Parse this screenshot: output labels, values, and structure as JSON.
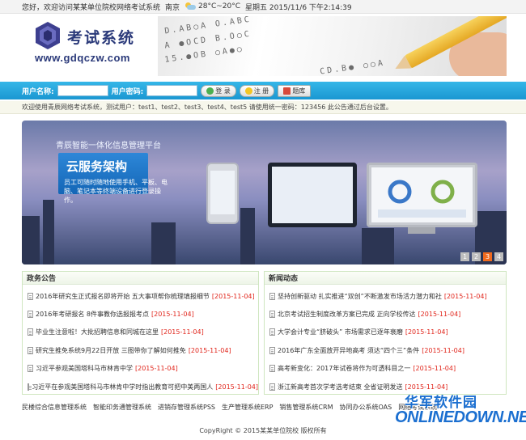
{
  "topbar": {
    "greeting": "您好，欢迎访问某某单位院校网络考试系统",
    "city": "南京",
    "temperature": "28°C~20°C",
    "datetime": "星期五 2015/11/6 下午2:14:39",
    "weather_icon": "partly-cloudy-icon"
  },
  "header": {
    "logo_title": "考试系统",
    "logo_url": "www.gdqczw.com",
    "banner_rows": [
      "D.AB○A O.ABC",
      "A ●OCD  B.O○C",
      "15.●OB  ○A●○",
      "CD.B● ○○A"
    ]
  },
  "login": {
    "username_label": "用户名称:",
    "password_label": "用户密码:",
    "login_button": "登 录",
    "register_button": "注 册",
    "question_bank_button": "题库"
  },
  "notice": {
    "text": "欢迎使用青辰网络考试系统，测试用户：test1、test2、test3、test4、test5 请使用统一密码：123456 此公告通过后台设置。"
  },
  "slider": {
    "subtitle": "青辰智能一体化信息管理平台",
    "headline": "云服务架构",
    "description": "员工可随时随地使用手机、平板、电脑、笔记本等终端设备进行登录操作。",
    "pages": [
      "1",
      "2",
      "3",
      "4"
    ],
    "active_page": "3"
  },
  "panels": {
    "left": {
      "title": "政务公告",
      "items": [
        {
          "text": "2016年研究生正式报名即将开始 五大事项帮你梳理填报细节",
          "date": "[2015-11-04]"
        },
        {
          "text": "2016年考研报名 8件事教你选报报考点",
          "date": "[2015-11-04]"
        },
        {
          "text": "毕业生注意啦！大批招聘信息和同城在这里",
          "date": "[2015-11-04]"
        },
        {
          "text": "研究生推免系统9月22日开放 三图带你了解如何推免",
          "date": "[2015-11-04]"
        },
        {
          "text": "习近平参观美国塔科马市林肯中学",
          "date": "[2015-11-04]"
        },
        {
          "text": "习近平在参观美国塔科马市林肯中学时指出教育可把中美两国人",
          "date": "[2015-11-04]"
        }
      ]
    },
    "right": {
      "title": "新闻动态",
      "items": [
        {
          "text": "坚持创新驱动 扎实推进“双创”不断激发市场活力潜力和社",
          "date": "[2015-11-04]"
        },
        {
          "text": "北京考试招生制度改革方案已完成 正向学校传达",
          "date": "[2015-11-04]"
        },
        {
          "text": "大学会计专业“脐破头” 市场需求已逐年衰磨",
          "date": "[2015-11-04]"
        },
        {
          "text": "2016年广东全面放开异地高考 须达“四个三”条件",
          "date": "[2015-11-04]"
        },
        {
          "text": "高考新变化：2017年试卷将作为可透科目之一",
          "date": "[2015-11-04]"
        },
        {
          "text": "浙江新高考首次学考选考结束 全省证明发送",
          "date": "[2015-11-04]"
        }
      ]
    }
  },
  "links": [
    "民楼综合信息管理系统",
    "智能印务通管理系统",
    "进销存管理系统PSS",
    "生产管理系统ERP",
    "销售管理系统CRM",
    "协同办公系统OAS",
    "网络考试系统"
  ],
  "footer": {
    "copyright": "CopyRight © 2015某某单位院校 版权所有"
  },
  "watermark": {
    "cn": "华军软件园",
    "en": "ONLINEDOWN.NET"
  },
  "colors": {
    "login_bar": "#1a97d2",
    "accent_orange": "#f06a1e",
    "date_red": "#e1251b",
    "panel_border": "#cfe6c0"
  }
}
